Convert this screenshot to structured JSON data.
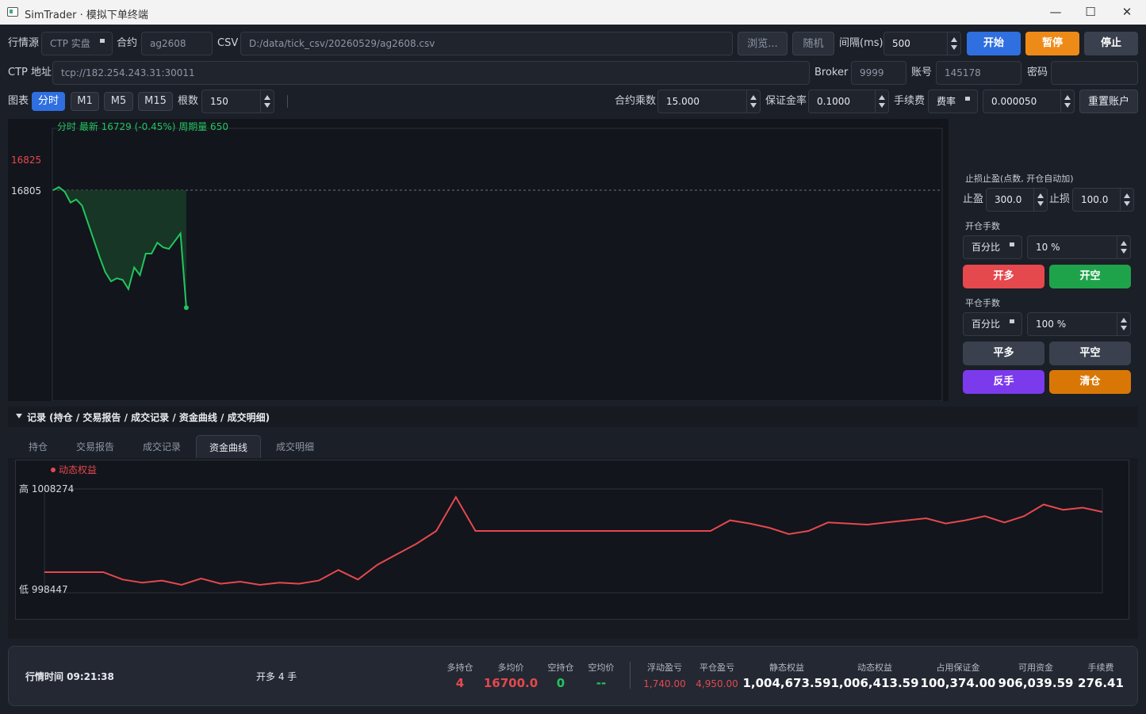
{
  "window": {
    "title": "SimTrader · 模拟下单终端",
    "minimize": "—",
    "maximize": "☐",
    "close": "✕"
  },
  "row1": {
    "source_label": "行情源",
    "source_value": "CTP 实盘",
    "contract_label": "合约",
    "contract_value": "ag2608",
    "csv_label": "CSV",
    "csv_value": "D:/data/tick_csv/20260529/ag2608.csv",
    "browse": "浏览...",
    "random": "随机",
    "interval_label": "间隔(ms)",
    "interval_value": "500",
    "start": "开始",
    "pause": "暂停",
    "stop": "停止"
  },
  "row2": {
    "ctp_label": "CTP 地址",
    "ctp_value": "tcp://182.254.243.31:30011",
    "broker_label": "Broker",
    "broker_value": "9999",
    "account_label": "账号",
    "account_value": "145178",
    "password_label": "密码",
    "password_value": ""
  },
  "row3": {
    "chart_label": "图表",
    "periods": [
      "分时",
      "M1",
      "M5",
      "M15"
    ],
    "active_period": "分时",
    "bars_label": "根数",
    "bars_value": "150",
    "multiplier_label": "合约乘数",
    "multiplier_value": "15.000",
    "margin_label": "保证金率",
    "margin_value": "0.1000",
    "fee_label": "手续费",
    "fee_mode": "费率",
    "fee_value": "0.000050",
    "reset": "重置账户"
  },
  "chart": {
    "header": "分时  最新 16729  (-0.45%)  周期量 650",
    "y_ticks": [
      "16825",
      "16805"
    ],
    "ref_price": 16805,
    "line_color": "#22c55e"
  },
  "chart_data": [
    {
      "type": "line",
      "title": "分时  最新 16729  (-0.45%)  周期量 650",
      "y_ticks": [
        16825,
        16805
      ],
      "reference_line": 16805,
      "series": [
        {
          "values": [
            16805,
            16807,
            16804,
            16797,
            16799,
            16795,
            16784,
            16773,
            16762,
            16752,
            16746,
            16748,
            16747,
            16741,
            16755,
            16750,
            16764,
            16764,
            16771,
            16768,
            16767,
            16772,
            16777,
            16729
          ]
        }
      ]
    },
    {
      "type": "line",
      "title": "",
      "y_labels": [
        "高 1008274",
        "低 998447"
      ],
      "ylim": [
        998447,
        1008274
      ],
      "series": [
        {
          "name": "动态权益",
          "values": [
            1000400,
            1000400,
            1000400,
            1000400,
            999700,
            999400,
            999600,
            999200,
            999800,
            999300,
            999500,
            999200,
            999400,
            999300,
            999600,
            1000600,
            999700,
            1001100,
            1002100,
            1003100,
            1004300,
            1007500,
            1004300,
            1004300,
            1004300,
            1004300,
            1004300,
            1004300,
            1004300,
            1004300,
            1004300,
            1004300,
            1004300,
            1004300,
            1004300,
            1005300,
            1005000,
            1004600,
            1004000,
            1004300,
            1005100,
            1005000,
            1004900,
            1005100,
            1005300,
            1005500,
            1005000,
            1005300,
            1005700,
            1005100,
            1005700,
            1006800,
            1006300,
            1006500,
            1006100
          ]
        }
      ]
    }
  ],
  "side": {
    "sltp_title": "止损止盈(点数, 开仓自动加)",
    "tp_label": "止盈",
    "tp_value": "300.0",
    "sl_label": "止损",
    "sl_value": "100.0",
    "open_title": "开仓手数",
    "open_mode": "百分比",
    "open_value": "10 %",
    "open_long": "开多",
    "open_short": "开空",
    "close_title": "平仓手数",
    "close_mode": "百分比",
    "close_value": "100 %",
    "close_long": "平多",
    "close_short": "平空",
    "reverse": "反手",
    "flatten": "清仓"
  },
  "records": {
    "header": "记录 (持仓 / 交易报告 / 成交记录 / 资金曲线 / 成交明细)",
    "tabs": [
      "持仓",
      "交易报告",
      "成交记录",
      "资金曲线",
      "成交明细"
    ],
    "active_tab": "资金曲线",
    "legend": "动态权益",
    "high_label": "高 1008274",
    "low_label": "低 998447",
    "line_color": "#e5484d"
  },
  "status": {
    "time_label": "行情时间 09:21:38",
    "last_action": "开多 4 手",
    "stats": [
      {
        "label": "多持仓",
        "value": "4",
        "color": "#e5484d"
      },
      {
        "label": "多均价",
        "value": "16700.0",
        "color": "#e5484d"
      },
      {
        "label": "空持仓",
        "value": "0",
        "color": "#22c55e"
      },
      {
        "label": "空均价",
        "value": "--",
        "color": "#22c55e"
      },
      {
        "label": "浮动盈亏",
        "value": "1,740.00",
        "color": "#e5484d"
      },
      {
        "label": "平仓盈亏",
        "value": "4,950.00",
        "color": "#e5484d"
      },
      {
        "label": "静态权益",
        "value": "1,004,673.59",
        "color": "#ffffff"
      },
      {
        "label": "动态权益",
        "value": "1,006,413.59",
        "color": "#ffffff"
      },
      {
        "label": "占用保证金",
        "value": "100,374.00",
        "color": "#ffffff"
      },
      {
        "label": "可用资金",
        "value": "906,039.59",
        "color": "#ffffff"
      },
      {
        "label": "手续费",
        "value": "276.41",
        "color": "#ffffff"
      }
    ]
  }
}
